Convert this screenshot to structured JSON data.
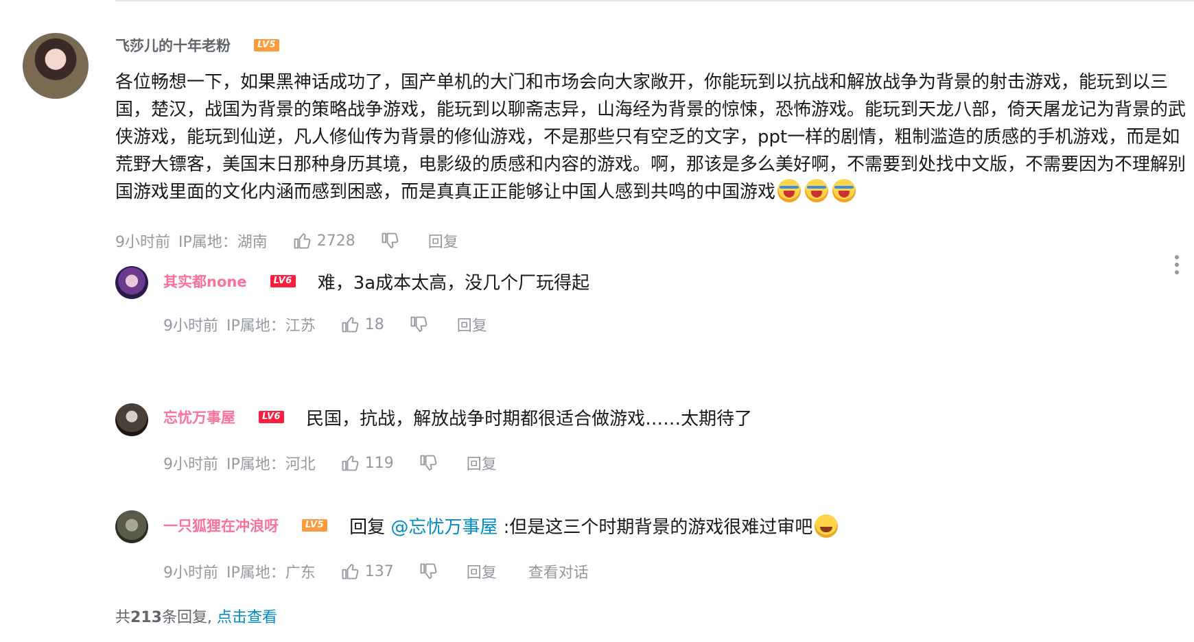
{
  "main": {
    "username": "飞莎儿的十年老粉",
    "level": "LV5",
    "text": "各位畅想一下，如果黑神话成功了，国产单机的大门和市场会向大家敞开，你能玩到以抗战和解放战争为背景的射击游戏，能玩到以三国，楚汉，战国为背景的策略战争游戏，能玩到以聊斋志异，山海经为背景的惊悚，恐怖游戏。能玩到天龙八部，倚天屠龙记为背景的武侠游戏，能玩到仙逆，凡人修仙传为背景的修仙游戏，不是那些只有空乏的文字，ppt一样的剧情，粗制滥造的质感的手机游戏，而是如荒野大镖客，美国末日那种身历其境，电影级的质感和内容的游戏。啊，那该是多么美好啊，不需要到处找中文版，不需要因为不理解别国游戏里面的文化内涵而感到困惑，而是真真正正能够让中国人感到共鸣的中国游戏",
    "emojis": [
      "cry-emoji",
      "cry-emoji",
      "cry-emoji"
    ],
    "time": "9小时前",
    "ip": "IP属地：湖南",
    "likes": "2728",
    "reply_label": "回复"
  },
  "replies": [
    {
      "username": "其实都none",
      "level": "LV6",
      "text": "难，3a成本太高，没几个厂玩得起",
      "time": "9小时前",
      "ip": "IP属地：江苏",
      "likes": "18",
      "reply_label": "回复"
    },
    {
      "username": "忘忧万事屋",
      "level": "LV6",
      "text": "民国，抗战，解放战争时期都很适合做游戏……太期待了",
      "time": "9小时前",
      "ip": "IP属地：河北",
      "likes": "119",
      "reply_label": "回复"
    },
    {
      "username": "一只狐狸在冲浪呀",
      "level": "LV5",
      "reply_prefix": "回复",
      "at_user": "@忘忧万事屋",
      "text": ":但是这三个时期背景的游戏很难过审吧",
      "time": "9小时前",
      "ip": "IP属地：广东",
      "likes": "137",
      "reply_label": "回复",
      "view_conversation": "查看对话"
    }
  ],
  "footer": {
    "prefix": "共",
    "count": "213",
    "suffix": "条回复,",
    "view_link": "点击查看"
  },
  "colors": {
    "username_main": "#61666d",
    "username_reply": "#fb7299",
    "link": "#008ac5",
    "meta": "#9499a0",
    "lv5": "#ff9a3c",
    "lv6": "#ff1c3d"
  }
}
